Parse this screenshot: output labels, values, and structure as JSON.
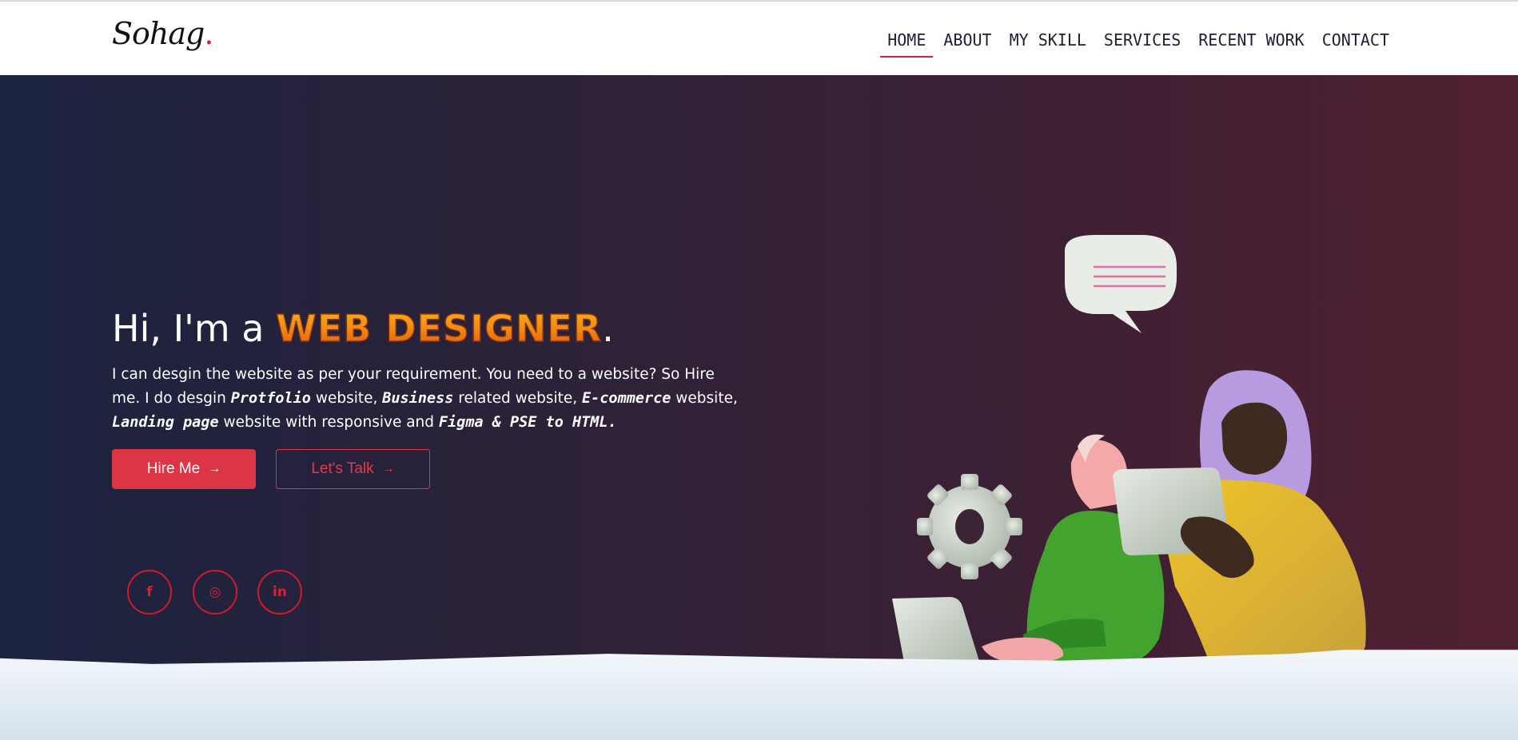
{
  "brand": {
    "name": "Sohag",
    "dot": "."
  },
  "nav": {
    "items": [
      {
        "label": "HOME",
        "active": true
      },
      {
        "label": "ABOUT",
        "active": false
      },
      {
        "label": "MY SKILL",
        "active": false
      },
      {
        "label": "SERVICES",
        "active": false
      },
      {
        "label": "RECENT WORK",
        "active": false
      },
      {
        "label": "CONTACT",
        "active": false
      }
    ]
  },
  "hero": {
    "greeting": "Hi, I'm a ",
    "role": "WEB DESIGNER",
    "period": ".",
    "desc": {
      "p1": "I can desgin the website as per your requirement. You need to a website? So Hire me. I do desgin ",
      "e1": "Protfolio",
      "p2": " website, ",
      "e2": "Business",
      "p3": " related website, ",
      "e3": "E-commerce",
      "p4": " website, ",
      "e4": "Landing page",
      "p5": " website with responsive and ",
      "e5": "Figma & PSE to HTML."
    },
    "buttons": {
      "hire": "Hire Me",
      "talk": "Let's Talk",
      "arrow_icon": "arrow-right-icon"
    },
    "social": [
      {
        "icon": "facebook-icon",
        "glyph": "f"
      },
      {
        "icon": "instagram-icon",
        "glyph": "◎"
      },
      {
        "icon": "linkedin-icon",
        "glyph": "in"
      }
    ]
  },
  "colors": {
    "accent": "#dc3545",
    "hero_gradient_start": "#1b2340",
    "hero_gradient_end": "#512131",
    "nav_text": "#1c2130"
  }
}
